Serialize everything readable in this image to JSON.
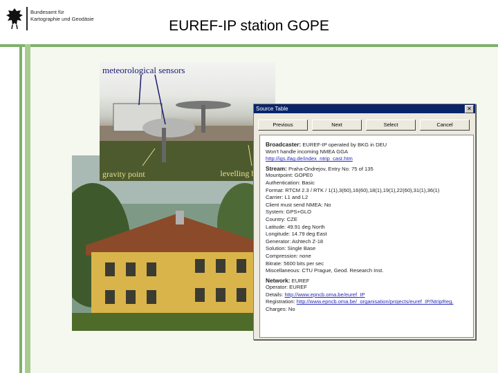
{
  "header": {
    "org_line1": "Bundesamt für",
    "org_line2": "Kartographie und Geodäsie",
    "title": "EUREF-IP station GOPE"
  },
  "photo_top": {
    "caption_sensors": "meteorological sensors",
    "caption_gravity": "gravity point",
    "caption_levelling": "levelling bench"
  },
  "dialog": {
    "title": "Source Table",
    "close_glyph": "✕",
    "buttons": [
      "Previous",
      "Next",
      "Select",
      "Cancel"
    ],
    "broadcaster": {
      "label": "Broadcaster:",
      "value": "EUREF-IP operated by BKG in DEU",
      "note": "Won't handle incoming NMEA GGA",
      "url": "http://igs.ifag.de/index_ntrip_cast.htm"
    },
    "stream": {
      "label": "Stream:",
      "value": "Praha-Ondrejov, Entry No: 75 of 135",
      "rows": [
        "Mountpoint: GOPE0",
        "Authentication: Basic",
        "Format: RTCM 2.3 / RTK / 1(1),3(60),16(60),18(1),19(1),22(60),31(1),36(1)",
        "Carrier: L1 and L2",
        "Client must send NMEA: No",
        "System: GPS+GLO",
        "Country: CZE",
        "Latitude: 49.91 deg North",
        "Longitude: 14.79 deg East",
        "Generator: Ashtech Z-18",
        "Solution: Single Base",
        "Compression: none",
        "Bitrate: 5600 bits per sec",
        "Miscellaneous: CTU Prague, Geod. Research Inst."
      ]
    },
    "network": {
      "label": "Network:",
      "value": "EUREF",
      "operator": "Operator: EUREF",
      "details_label": "Details:",
      "details_url": "http://www.epncb.oma.be/euref_IP",
      "registration_label": "Registration:",
      "registration_url": "http://www.epncb.oma.be/_organisation/projects/euref_IP/NtripReg.",
      "charges": "Charges: No"
    }
  },
  "colors": {
    "accent_green": "#7fb06a",
    "light_green": "#a7cc90",
    "title_bar": "#0a246a",
    "link": "#2a2ab8"
  }
}
